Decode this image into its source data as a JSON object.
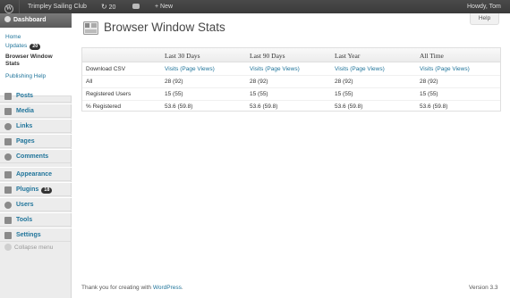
{
  "adminbar": {
    "site_name": "Trimpley Sailing Club",
    "updates_count": "20",
    "new_label": "+ New",
    "greeting": "Howdy, Tom"
  },
  "sidebar": {
    "dashboard_label": "Dashboard",
    "submenu": [
      {
        "label": "Home"
      },
      {
        "label": "Updates",
        "badge": "20"
      },
      {
        "label": "Browser Window Stats"
      },
      {
        "label": "Publishing Help"
      }
    ],
    "items": [
      {
        "label": "Posts",
        "icon": "pin-icon"
      },
      {
        "label": "Media",
        "icon": "media-icon"
      },
      {
        "label": "Links",
        "icon": "links-icon"
      },
      {
        "label": "Pages",
        "icon": "pages-icon"
      },
      {
        "label": "Comments",
        "icon": "comments-icon"
      },
      {
        "label": "Appearance",
        "icon": "appearance-icon"
      },
      {
        "label": "Plugins",
        "icon": "plugins-icon",
        "badge": "18"
      },
      {
        "label": "Users",
        "icon": "users-icon"
      },
      {
        "label": "Tools",
        "icon": "tools-icon"
      },
      {
        "label": "Settings",
        "icon": "settings-icon"
      }
    ],
    "collapse_label": "Collapse menu"
  },
  "help_label": "Help",
  "page_title": "Browser Window Stats",
  "table": {
    "headers": [
      "",
      "Last 30 Days",
      "Last 90 Days",
      "Last Year",
      "All Time"
    ],
    "rows": [
      {
        "label": "Download CSV",
        "values": [
          "Visits (Page Views)",
          "Visits (Page Views)",
          "Visits (Page Views)",
          "Visits (Page Views)"
        ]
      },
      {
        "label": "All",
        "values": [
          "28 (92)",
          "28 (92)",
          "28 (92)",
          "28 (92)"
        ]
      },
      {
        "label": "Registered Users",
        "values": [
          "15 (55)",
          "15 (55)",
          "15 (55)",
          "15 (55)"
        ]
      },
      {
        "label": "% Registered",
        "values": [
          "53.6 (59.8)",
          "53.6 (59.8)",
          "53.6 (59.8)",
          "53.6 (59.8)"
        ]
      }
    ]
  },
  "footer": {
    "thanks_prefix": "Thank you for creating with ",
    "wordpress_link": "WordPress",
    "thanks_suffix": ".",
    "version": "Version 3.3"
  },
  "colors": {
    "link": "#21759b",
    "adminbar": "#464646",
    "sidebar": "#ececec"
  }
}
